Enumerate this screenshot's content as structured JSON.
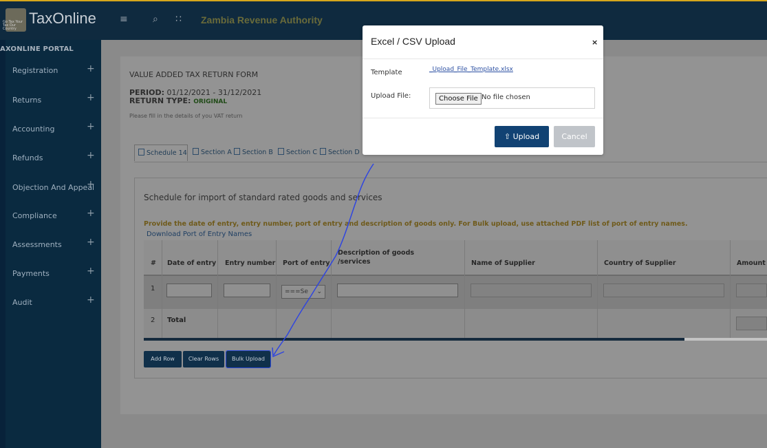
{
  "topbar": {
    "brand": "TaxOnline",
    "crest_text": "Go Tax Your Tax Our Country",
    "menu_icon": "hamburger-icon",
    "search_icon": "search-icon",
    "apps_icon": "grid-icon",
    "title": "Zambia Revenue Authority"
  },
  "sidebar": {
    "header": "AXONLINE PORTAL",
    "items": [
      {
        "label": "Registration"
      },
      {
        "label": "Returns"
      },
      {
        "label": "Accounting"
      },
      {
        "label": "Refunds"
      },
      {
        "label": "Objection And Appeal"
      },
      {
        "label": "Compliance"
      },
      {
        "label": "Assessments"
      },
      {
        "label": "Payments"
      },
      {
        "label": "Audit"
      }
    ],
    "expand_symbol": "+"
  },
  "form": {
    "title": "VALUE ADDED TAX RETURN FORM",
    "period_label": "PERIOD:",
    "period_value": "01/12/2021 - 31/12/2021",
    "return_type_label": "RETURN TYPE:",
    "return_type_value": "ORIGINAL",
    "note": "Please fill in the details of you VAT return"
  },
  "tabs": [
    "Schedule 14",
    "Section A",
    "Section B",
    "Section C",
    "Section D"
  ],
  "schedule": {
    "title": "Schedule for import of standard rated goods and services",
    "instruction": "Provide the date of entry, entry number, port of entry and description of goods only. For Bulk upload, use attached PDF list of port of entry names.",
    "download_link": "Download Port of Entry Names",
    "columns": [
      "#",
      "Date of entry",
      "Entry number",
      "Port of entry",
      "Description of goods",
      "/services",
      "Name of Supplier",
      "Country of Supplier",
      "Amount"
    ],
    "rows": [
      {
        "num": "1",
        "port_select": "===Se"
      },
      {
        "num": "2",
        "label": "Total"
      }
    ],
    "buttons": {
      "add": "Add Row",
      "clear": "Clear Rows",
      "bulk": "Bulk Upload"
    }
  },
  "modal": {
    "title": "Excel / CSV Upload",
    "close": "×",
    "template_label": "Template",
    "template_link": "_Upload_File_Template.xlsx",
    "upload_label": "Upload File:",
    "choose_button": "Choose File",
    "no_file": "No file chosen",
    "upload_button": "Upload",
    "upload_icon": "upload-icon",
    "cancel_button": "Cancel"
  },
  "colors": {
    "annotation_arrow": "#2f45e0",
    "primary": "#114273"
  }
}
